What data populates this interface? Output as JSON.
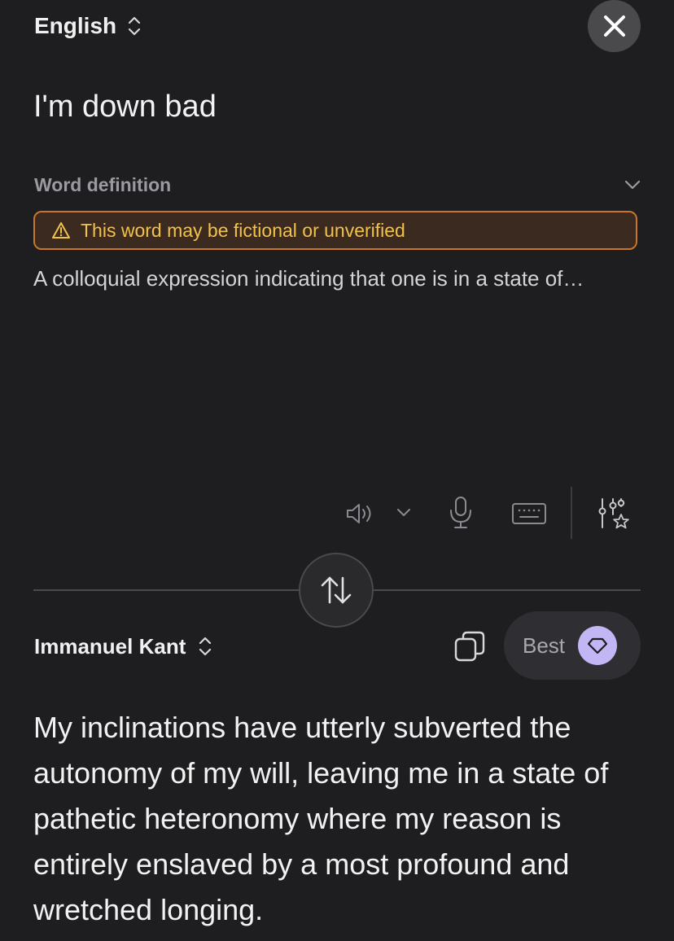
{
  "source": {
    "language": "English",
    "text": "I'm down bad"
  },
  "definition": {
    "title": "Word definition",
    "warning": "This word may be fictional or unverified",
    "text": "A colloquial expression indicating that one is in a state of…"
  },
  "toolbar": {
    "icons": [
      "speaker-icon",
      "chevron-down-icon",
      "microphone-icon",
      "keyboard-icon",
      "sliders-star-icon"
    ]
  },
  "target": {
    "language": "Immanuel Kant",
    "mode_label": "Best",
    "text": "My inclinations have utterly subverted the autonomy of my will, leaving me in a state of pathetic heteronomy where my reason is entirely enslaved by a most profound and wretched longing."
  },
  "colors": {
    "background": "#1e1e20",
    "warning_border": "#c7762a",
    "warning_text": "#f2c14a",
    "accent_badge": "#c3b6f5"
  }
}
